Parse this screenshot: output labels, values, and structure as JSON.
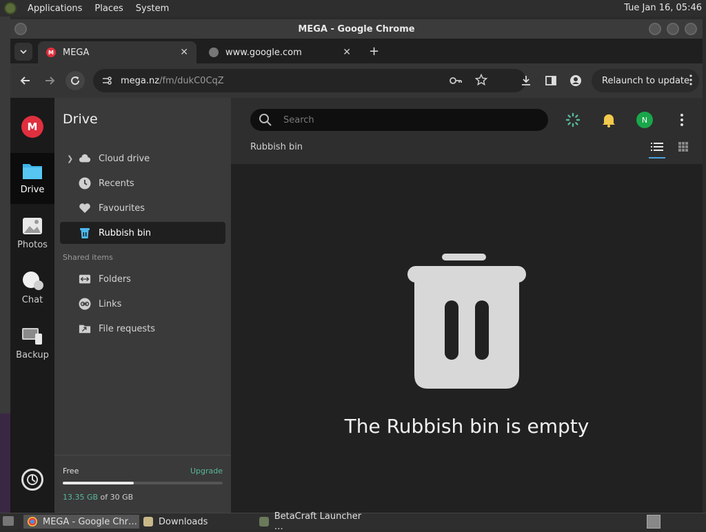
{
  "desktop": {
    "menus": [
      "Applications",
      "Places",
      "System"
    ],
    "clock": "Tue Jan 16, 05:46"
  },
  "window": {
    "title": "MEGA - Google Chrome"
  },
  "tabs": [
    {
      "label": "MEGA",
      "active": true
    },
    {
      "label": "www.google.com",
      "active": false
    }
  ],
  "toolbar": {
    "url_host": "mega.nz",
    "url_path": "/fm/dukC0CqZ",
    "relaunch_label": "Relaunch to update"
  },
  "rail": {
    "logo": "M",
    "items": [
      {
        "label": "Drive",
        "active": true
      },
      {
        "label": "Photos",
        "active": false
      },
      {
        "label": "Chat",
        "active": false
      },
      {
        "label": "Backup",
        "active": false
      }
    ]
  },
  "sidebar": {
    "title": "Drive",
    "items": [
      {
        "label": "Cloud drive",
        "icon": "cloud-icon"
      },
      {
        "label": "Recents",
        "icon": "clock-icon"
      },
      {
        "label": "Favourites",
        "icon": "heart-icon"
      },
      {
        "label": "Rubbish bin",
        "icon": "trash-icon",
        "active": true
      }
    ],
    "shared_title": "Shared items",
    "shared_items": [
      {
        "label": "Folders",
        "icon": "shared-folder-icon"
      },
      {
        "label": "Links",
        "icon": "link-icon"
      },
      {
        "label": "File requests",
        "icon": "file-request-icon"
      }
    ],
    "storage": {
      "plan": "Free",
      "upgrade_label": "Upgrade",
      "used": "13.35 GB",
      "of_total": " of 30 GB",
      "fraction": 0.445
    }
  },
  "main": {
    "search_placeholder": "Search",
    "avatar": "N",
    "breadcrumb": "Rubbish bin",
    "empty_message": "The Rubbish bin is empty"
  },
  "taskbar": {
    "items": [
      {
        "label": "MEGA - Google Chr…",
        "active": true
      },
      {
        "label": "Downloads",
        "active": false
      },
      {
        "label": "BetaCraft Launcher …",
        "active": false
      }
    ]
  },
  "colors": {
    "mega_red": "#e02f3e",
    "accent_green": "#58b89b",
    "accent_blue": "#4aa3df"
  }
}
